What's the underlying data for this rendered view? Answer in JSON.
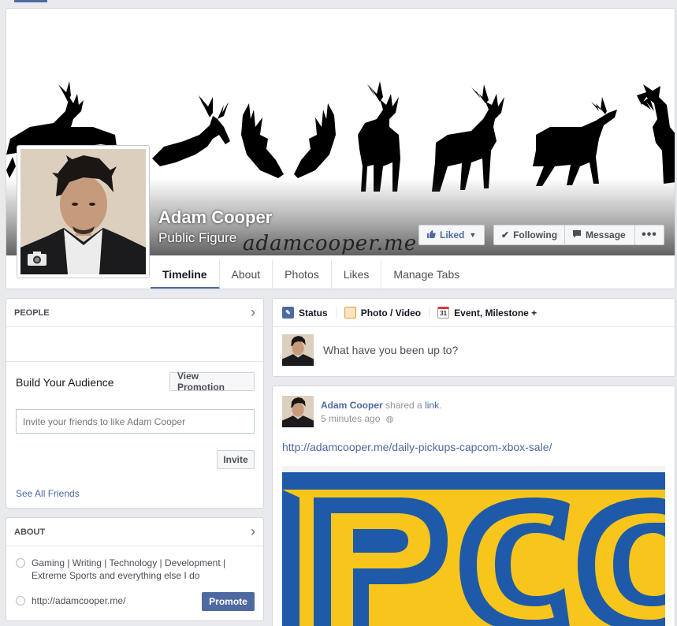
{
  "profile": {
    "name": "Adam Cooper",
    "category": "Public Figure",
    "signature": "adamcooper.me"
  },
  "cover_buttons": {
    "liked": "Liked",
    "following": "Following",
    "message": "Message",
    "more": "•••"
  },
  "tabs": [
    {
      "label": "Timeline",
      "active": true
    },
    {
      "label": "About"
    },
    {
      "label": "Photos"
    },
    {
      "label": "Likes"
    },
    {
      "label": "Manage Tabs"
    }
  ],
  "people_card": {
    "title": "PEOPLE",
    "build_audience": "Build Your Audience",
    "view_promotion": "View Promotion",
    "invite_placeholder": "Invite your friends to like Adam Cooper",
    "invite_button": "Invite",
    "see_all": "See All Friends"
  },
  "about_card": {
    "title": "ABOUT",
    "description": "Gaming | Writing | Technology | Development | Extreme Sports and everything else I do",
    "website": "http://adamcooper.me/",
    "promote": "Promote"
  },
  "composer": {
    "tabs": [
      {
        "label": "Status",
        "icon": "pencil-icon"
      },
      {
        "label": "Photo / Video",
        "icon": "photo-icon"
      },
      {
        "label": "Event, Milestone +",
        "icon": "calendar-icon",
        "icon_text": "31"
      }
    ],
    "placeholder": "What have you been up to?"
  },
  "post": {
    "author": "Adam Cooper",
    "action": "shared a",
    "link_word": "link",
    "period": ".",
    "time": "5 minutes ago",
    "url": "http://adamcooper.me/daily-pickups-capcom-xbox-sale/"
  },
  "colors": {
    "brand_blue": "#4e69a2",
    "capcom_yellow": "#f8c51c",
    "capcom_blue": "#1e5aa8"
  }
}
